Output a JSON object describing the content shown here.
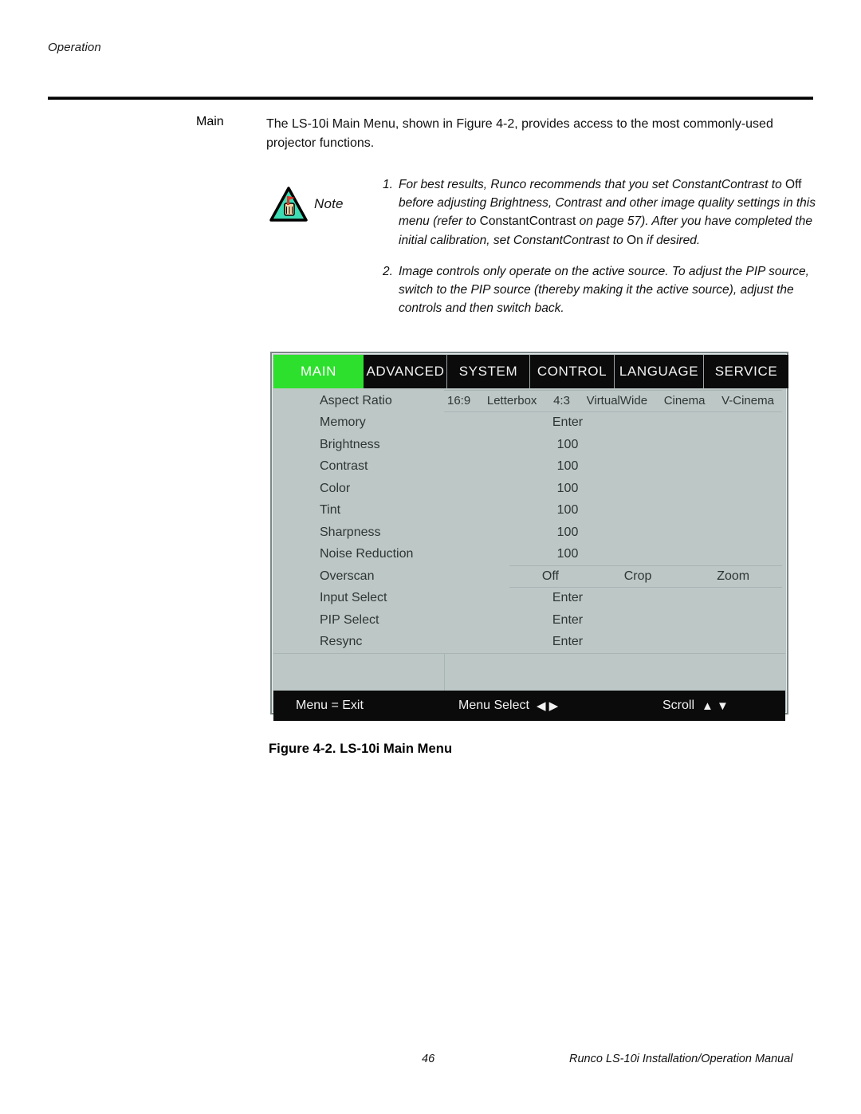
{
  "page": {
    "running_head": "Operation",
    "page_number": "46",
    "footer_text": "Runco LS-10i Installation/Operation Manual"
  },
  "section": {
    "label": "Main",
    "paragraph": "The LS-10i Main Menu, shown in Figure 4-2, provides access to the most commonly-used projector functions."
  },
  "note": {
    "word": "Note",
    "icon": "note-hand-triangle-icon",
    "triangle_color": "#3ddcb4",
    "items": [
      {
        "number": "1.",
        "part1": "For best results, Runco recommends that you set ConstantContrast to ",
        "bold1": "Off",
        "part2": " before adjusting Brightness, Contrast and other image quality settings in this menu (refer to ",
        "bold2": "ConstantContrast",
        "part3": " on page 57). After you have completed the initial calibration, set ConstantContrast to ",
        "bold3": "On",
        "part4": " if desired."
      },
      {
        "number": "2.",
        "text": "Image controls only operate on the active source. To adjust the PIP source, switch to the PIP source (thereby making it the active source), adjust the controls and then switch back."
      }
    ]
  },
  "osd": {
    "accent_green": "#2ee02e",
    "panel_bg": "#bdc7c6",
    "bar_bg": "#0b0b0b",
    "tabs": [
      {
        "label": "MAIN",
        "active": true
      },
      {
        "label": "ADVANCED",
        "active": false
      },
      {
        "label": "SYSTEM",
        "active": false
      },
      {
        "label": "CONTROL",
        "active": false
      },
      {
        "label": "LANGUAGE",
        "active": false
      },
      {
        "label": "SERVICE",
        "active": false
      }
    ],
    "aspect_ratio": {
      "label": "Aspect Ratio",
      "options": [
        "16:9",
        "Letterbox",
        "4:3",
        "VirtualWide",
        "Cinema",
        "V-Cinema"
      ]
    },
    "rows": [
      {
        "label": "Memory",
        "value": "Enter"
      },
      {
        "label": "Brightness",
        "value": "100"
      },
      {
        "label": "Contrast",
        "value": "100"
      },
      {
        "label": "Color",
        "value": "100"
      },
      {
        "label": "Tint",
        "value": "100"
      },
      {
        "label": "Sharpness",
        "value": "100"
      },
      {
        "label": "Noise Reduction",
        "value": "100"
      }
    ],
    "overscan": {
      "label": "Overscan",
      "options": [
        "Off",
        "Crop",
        "Zoom"
      ]
    },
    "rows_after": [
      {
        "label": "Input Select",
        "value": "Enter"
      },
      {
        "label": "PIP Select",
        "value": "Enter"
      },
      {
        "label": "Resync",
        "value": "Enter"
      }
    ],
    "footer": {
      "exit": "Menu = Exit",
      "select": "Menu Select",
      "select_arrows": "◀ ▶",
      "scroll": "Scroll",
      "scroll_arrows": "▲ ▼"
    }
  },
  "figure": {
    "caption": "Figure 4-2. LS-10i Main Menu"
  }
}
